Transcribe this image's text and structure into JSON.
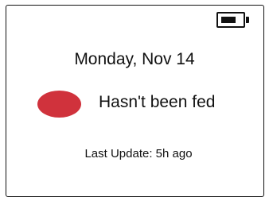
{
  "date_label": "Monday, Nov 14",
  "status": {
    "text": "Hasn't been fed",
    "indicator_color": "#d0323c",
    "indicator_icon": "status-dot-icon"
  },
  "last_update": "Last Update: 5h ago",
  "battery": {
    "icon": "battery-icon",
    "level": 0.75,
    "color": "#111111"
  }
}
